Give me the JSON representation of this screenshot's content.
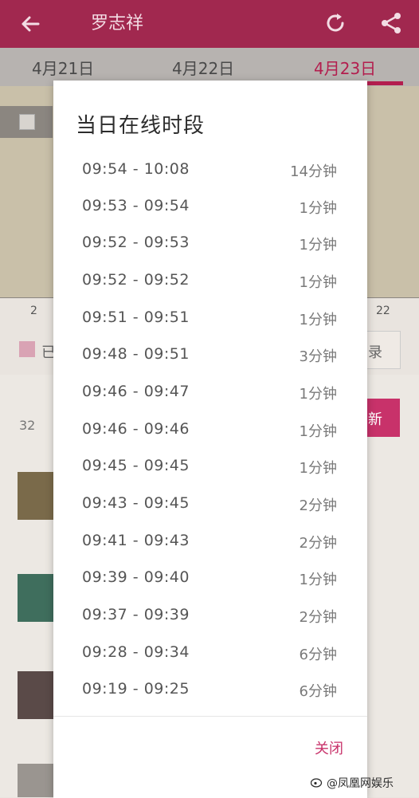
{
  "header": {
    "title": "罗志祥",
    "back_icon": "arrow-left-icon",
    "refresh_icon": "refresh-icon",
    "share_icon": "share-icon"
  },
  "date_tabs": [
    {
      "label": "4月21日",
      "active": false
    },
    {
      "label": "4月22日",
      "active": false
    },
    {
      "label": "4月23日",
      "active": true
    }
  ],
  "background": {
    "axis_labels": [
      "2",
      "22"
    ],
    "legend_label": "已",
    "record_label": "录",
    "refresh_label": "新",
    "count_label": "32"
  },
  "dialog": {
    "title": "当日在线时段",
    "sessions": [
      {
        "range": "09:54 - 10:08",
        "duration": "14分钟"
      },
      {
        "range": "09:53 - 09:54",
        "duration": "1分钟"
      },
      {
        "range": "09:52 - 09:53",
        "duration": "1分钟"
      },
      {
        "range": "09:52 - 09:52",
        "duration": "1分钟"
      },
      {
        "range": "09:51 - 09:51",
        "duration": "1分钟"
      },
      {
        "range": "09:48 - 09:51",
        "duration": "3分钟"
      },
      {
        "range": "09:46 - 09:47",
        "duration": "1分钟"
      },
      {
        "range": "09:46 - 09:46",
        "duration": "1分钟"
      },
      {
        "range": "09:45 - 09:45",
        "duration": "1分钟"
      },
      {
        "range": "09:43 - 09:45",
        "duration": "2分钟"
      },
      {
        "range": "09:41 - 09:43",
        "duration": "2分钟"
      },
      {
        "range": "09:39 - 09:40",
        "duration": "1分钟"
      },
      {
        "range": "09:37 - 09:39",
        "duration": "2分钟"
      },
      {
        "range": "09:28 - 09:34",
        "duration": "6分钟"
      },
      {
        "range": "09:19 - 09:25",
        "duration": "6分钟"
      }
    ],
    "close_label": "关闭"
  },
  "watermark": "@凤凰网娱乐",
  "colors": {
    "header": "#a1284f",
    "accent": "#c8326a"
  }
}
